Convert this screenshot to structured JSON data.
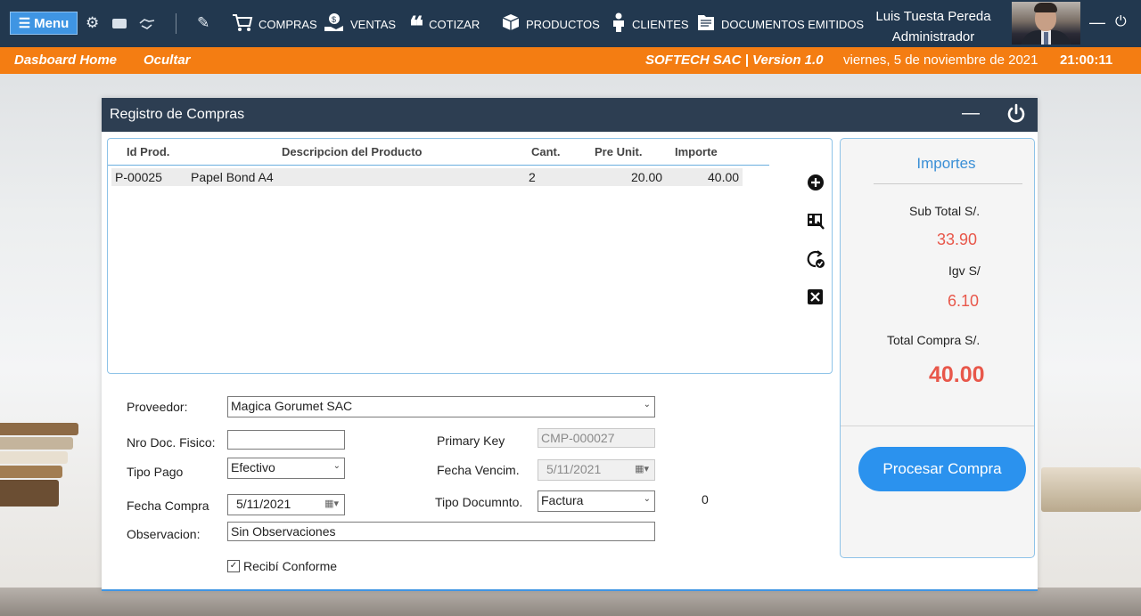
{
  "topbar": {
    "menu_label": "Menu",
    "nav": [
      {
        "label": "COMPRAS",
        "icon": "cart-icon"
      },
      {
        "label": "VENTAS",
        "icon": "money-hand-icon"
      },
      {
        "label": "COTIZAR",
        "icon": "quote-icon"
      },
      {
        "label": "PRODUCTOS",
        "icon": "boxes-icon"
      },
      {
        "label": "CLIENTES",
        "icon": "people-icon"
      },
      {
        "label": "DOCUMENTOS EMITIDOS",
        "icon": "documents-icon"
      }
    ],
    "user_name": "Luis Tuesta Pereda",
    "user_role": "Administrador"
  },
  "orangebar": {
    "home": "Dasboard Home",
    "hide": "Ocultar",
    "company": "SOFTECH SAC | Version 1.0",
    "date": "viernes, 5 de noviembre de 2021",
    "time": "21:00:11"
  },
  "form": {
    "title": "Registro de Compras",
    "grid": {
      "headers": [
        "Id Prod.",
        "Descripcion del Producto",
        "Cant.",
        "Pre Unit.",
        "Importe"
      ],
      "rows": [
        {
          "id": "P-00025",
          "desc": "Papel Bond A4",
          "cant": "2",
          "pre": "20.00",
          "importe": "40.00"
        }
      ]
    },
    "importes": {
      "title": "Importes",
      "subtotal_label": "Sub Total S/.",
      "subtotal": "33.90",
      "igv_label": "Igv S/",
      "igv": "6.10",
      "total_label": "Total Compra S/.",
      "total": "40.00",
      "process_label": "Procesar Compra"
    },
    "fields": {
      "proveedor_label": "Proveedor:",
      "proveedor": "Magica Gorumet SAC",
      "nro_doc_label": "Nro Doc. Fisico:",
      "nro_doc": "",
      "primary_key_label": "Primary Key",
      "primary_key": "CMP-000027",
      "tipo_pago_label": "Tipo Pago",
      "tipo_pago": "Efectivo",
      "fecha_venc_label": "Fecha Vencim.",
      "fecha_venc": "5/11/2021",
      "fecha_compra_label": "Fecha Compra",
      "fecha_compra": "5/11/2021",
      "tipo_doc_label": "Tipo Documnto.",
      "tipo_doc": "Factura",
      "counter": "0",
      "observacion_label": "Observacion:",
      "observacion": "Sin Observaciones",
      "recibi_label": "Recibí Conforme"
    }
  },
  "colors": {
    "topbar": "#22384f",
    "orange": "#f47d12",
    "accent_blue": "#2b92ee",
    "amount_red": "#e8574a"
  }
}
